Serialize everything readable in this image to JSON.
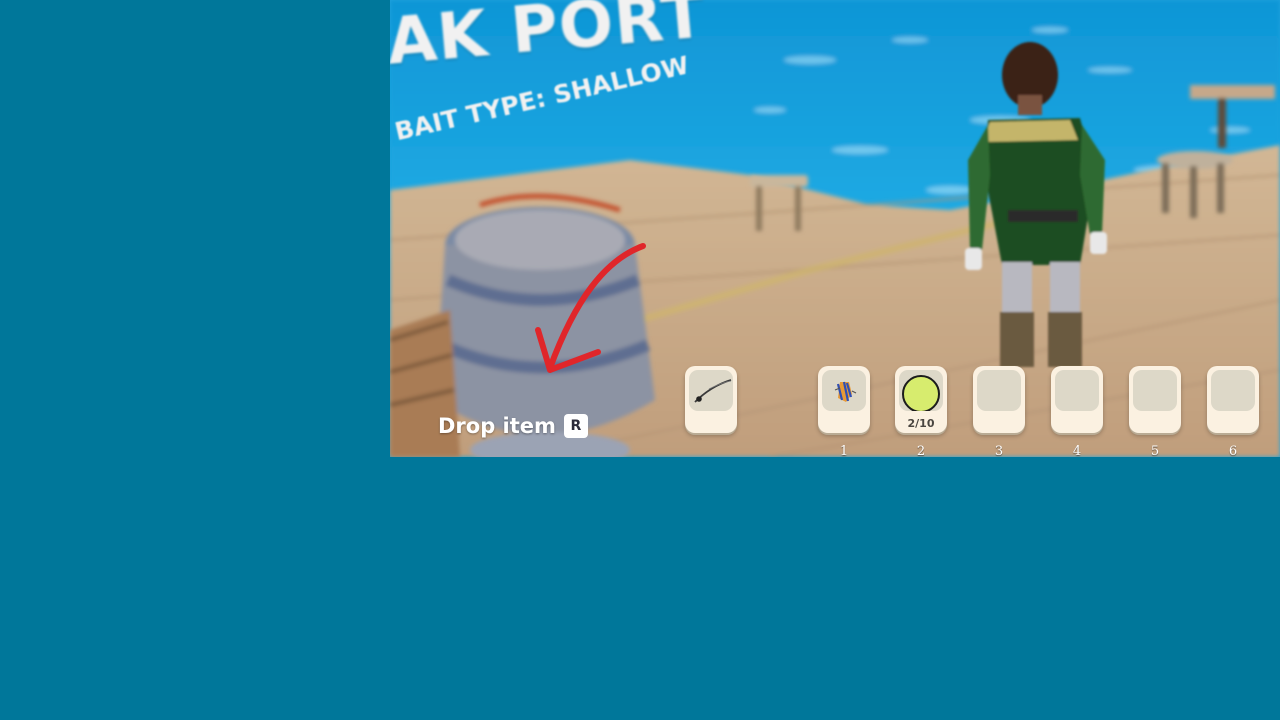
{
  "hud": {
    "area_title": "AK PORT",
    "bait_type": "BAIT TYPE: SHALLOW",
    "drop_label": "Drop item",
    "drop_key": "R"
  },
  "equipped": {
    "icon": "fishing-rod-icon"
  },
  "hotbar": [
    {
      "number": "1",
      "icon": "lure-icon",
      "count": ""
    },
    {
      "number": "2",
      "icon": "green-bait-ball-icon",
      "count": "2/10"
    },
    {
      "number": "3",
      "icon": "",
      "count": ""
    },
    {
      "number": "4",
      "icon": "",
      "count": ""
    },
    {
      "number": "5",
      "icon": "",
      "count": ""
    },
    {
      "number": "6",
      "icon": "",
      "count": ""
    }
  ],
  "colors": {
    "backdrop": "#00779a",
    "sea": "#19a3dd",
    "dock": "#c8ad8c",
    "slot_bg": "#fbf1e1",
    "annotation_arrow": "#e0262a"
  }
}
